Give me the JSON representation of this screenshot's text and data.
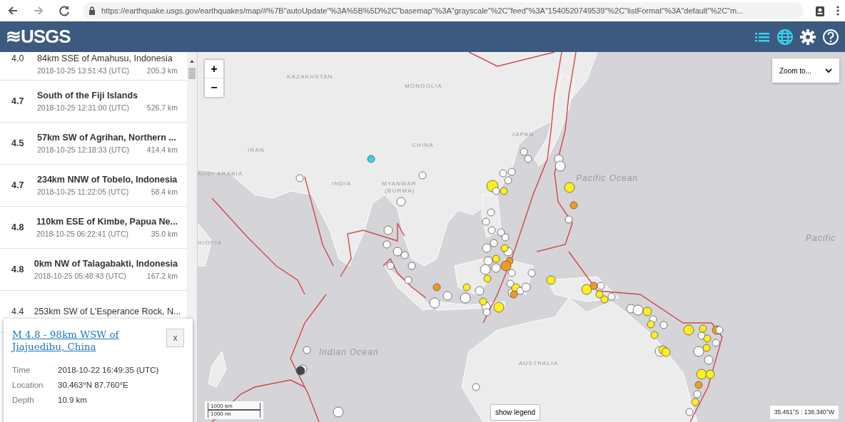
{
  "browser": {
    "url": "https://earthquake.usgs.gov/earthquakes/map/#%7B\"autoUpdate\"%3A%5B%5D%2C\"basemap\"%3A\"grayscale\"%2C\"feed\"%3A\"1540520749539\"%2C\"listFormat\"%3A\"default\"%2C\"m..."
  },
  "header": {
    "logo": "≋USGS",
    "tools": [
      {
        "kind": "list",
        "selected": true
      },
      {
        "kind": "map",
        "selected": true
      },
      {
        "kind": "settings",
        "selected": false
      },
      {
        "kind": "help",
        "selected": false
      }
    ]
  },
  "earthquakes": [
    {
      "magnitude": "4.0",
      "place": "84km SSE of Amahusu, Indonesia",
      "time": "2018-10-25 13:51:43 (UTC)",
      "depth": "205.3 km",
      "bold": false
    },
    {
      "magnitude": "4.7",
      "place": "South of the Fiji Islands",
      "time": "2018-10-25 12:31:00 (UTC)",
      "depth": "526.7 km",
      "bold": true
    },
    {
      "magnitude": "4.5",
      "place": "57km SW of Agrihan, Northern ...",
      "time": "2018-10-25 12:18:33 (UTC)",
      "depth": "414.4 km",
      "bold": true
    },
    {
      "magnitude": "4.7",
      "place": "234km NNW of Tobelo, Indonesia",
      "time": "2018-10-25 11:22:05 (UTC)",
      "depth": "58.4 km",
      "bold": true
    },
    {
      "magnitude": "4.8",
      "place": "110km ESE of Kimbe, Papua Ne...",
      "time": "2018-10-25 06:22:41 (UTC)",
      "depth": "35.0 km",
      "bold": true
    },
    {
      "magnitude": "4.8",
      "place": "0km NW of Talagabakti, Indonesia",
      "time": "2018-10-25 05:48:43 (UTC)",
      "depth": "167.2 km",
      "bold": true
    },
    {
      "magnitude": "4.4",
      "place": "253km SW of L'Esperance Rock, N...",
      "bold": false
    }
  ],
  "popup": {
    "title": "M 4.8 - 98km WSW of Jiajuedibu, China",
    "close": "x",
    "details": [
      {
        "label": "Time",
        "value": "2018-10-22 16:49:35 (UTC)"
      },
      {
        "label": "Location",
        "value": "30.463°N 87.760°E"
      },
      {
        "label": "Depth",
        "value": "10.9 km"
      }
    ]
  },
  "map": {
    "zoom_in": "+",
    "zoom_out": "−",
    "zoom_to": {
      "label": "Zoom to..."
    },
    "labels": [
      {
        "text": "KAZAKHSTAN",
        "kind": "country"
      },
      {
        "text": "MONGOLIA",
        "kind": "country"
      },
      {
        "text": "CHINA",
        "kind": "country"
      },
      {
        "text": "IRAN",
        "kind": "country"
      },
      {
        "text": "AUDI ARABIA",
        "kind": "country"
      },
      {
        "text": "INDIA",
        "kind": "country"
      },
      {
        "text": "MYANMAR",
        "kind": "country"
      },
      {
        "text": "(BURMA)",
        "kind": "country"
      },
      {
        "text": "JAPAN",
        "kind": "country"
      },
      {
        "text": "HIOPIA",
        "kind": "country"
      },
      {
        "text": "Pacific Ocean",
        "kind": "ocean"
      },
      {
        "text": "Pacific",
        "kind": "ocean"
      },
      {
        "text": "Indian Ocean",
        "kind": "ocean"
      },
      {
        "text": "AUSTRALIA",
        "kind": "country"
      }
    ],
    "scale": [
      "1000 km",
      "1000 mi"
    ],
    "legend_button": "show legend",
    "coordinates": "35.461°S : 138.340°W"
  }
}
